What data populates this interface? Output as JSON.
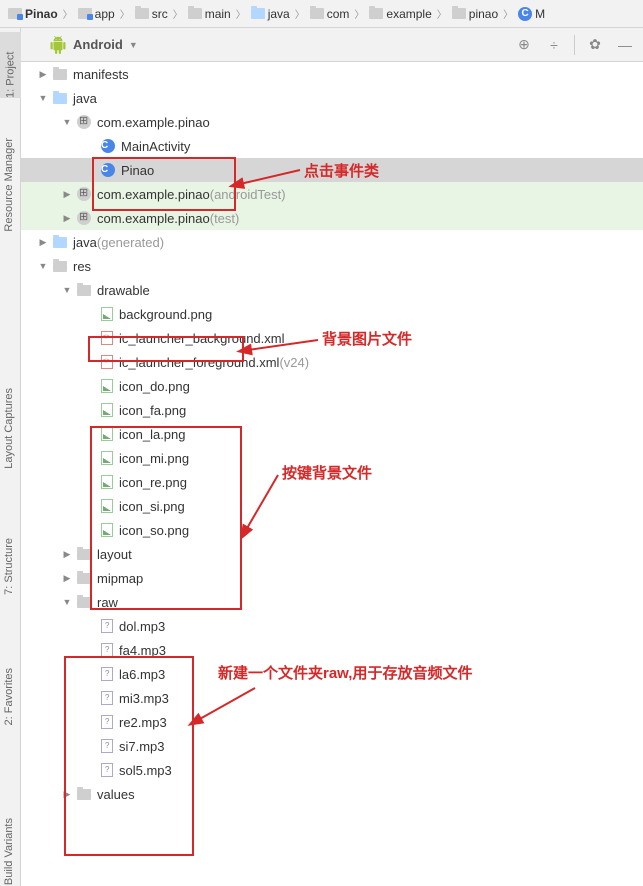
{
  "breadcrumb": [
    "Pinao",
    "app",
    "src",
    "main",
    "java",
    "com",
    "example",
    "pinao",
    "M"
  ],
  "toolbar": {
    "label": "Android"
  },
  "tree": {
    "manifests": "manifests",
    "java": "java",
    "pkg_main": "com.example.pinao",
    "main_activity": "MainActivity",
    "pinao_class": "Pinao",
    "pkg_atest": "com.example.pinao",
    "pkg_atest_sfx": "(androidTest)",
    "pkg_test": "com.example.pinao",
    "pkg_test_sfx": "(test)",
    "java_gen": "java",
    "java_gen_sfx": "(generated)",
    "res": "res",
    "drawable": "drawable",
    "bg_png": "background.png",
    "launcher_bg": "ic_launcher_background.xml",
    "launcher_fg": "ic_launcher_foreground.xml",
    "launcher_fg_sfx": "(v24)",
    "icons": [
      "icon_do.png",
      "icon_fa.png",
      "icon_la.png",
      "icon_mi.png",
      "icon_re.png",
      "icon_si.png",
      "icon_so.png"
    ],
    "layout": "layout",
    "mipmap": "mipmap",
    "raw": "raw",
    "audio": [
      "dol.mp3",
      "fa4.mp3",
      "la6.mp3",
      "mi3.mp3",
      "re2.mp3",
      "si7.mp3",
      "sol5.mp3"
    ],
    "values": "values"
  },
  "sidebar_tabs": [
    "1: Project",
    "Resource Manager",
    "Layout Captures",
    "7: Structure",
    "2: Favorites",
    "Build Variants"
  ],
  "annotations": {
    "click_event": "点击事件类",
    "bg_file": "背景图片文件",
    "key_bg": "按键背景文件",
    "raw_folder": "新建一个文件夹raw,用于存放音频文件"
  }
}
